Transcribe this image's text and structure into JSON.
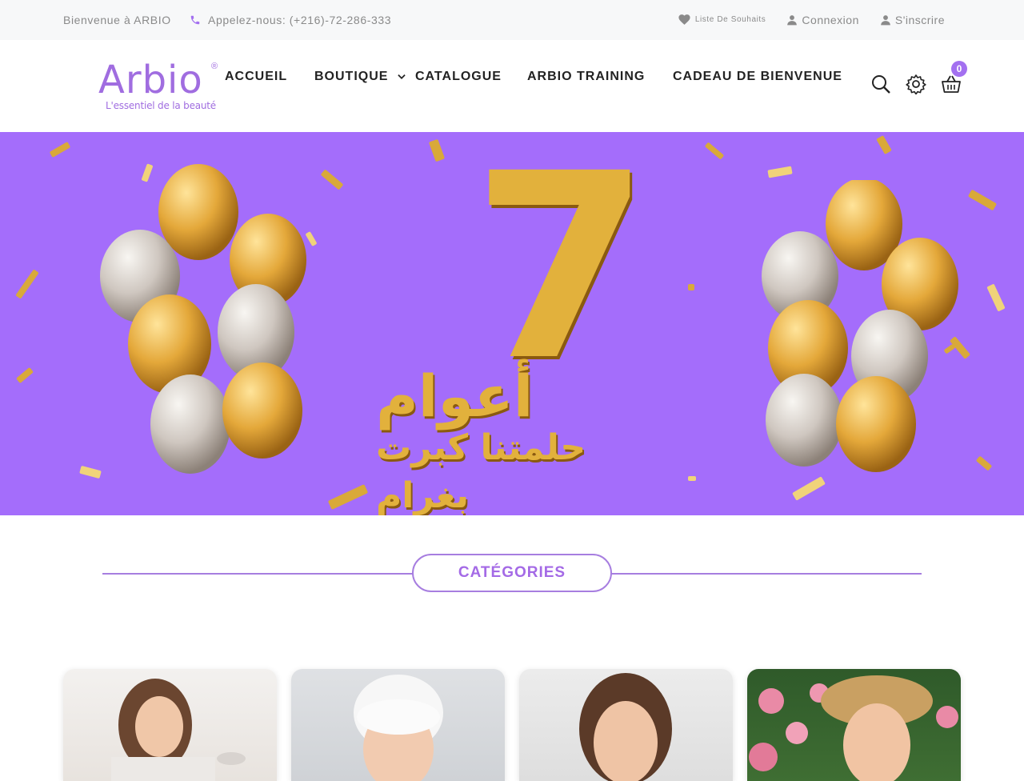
{
  "topbar": {
    "welcome": "Bienvenue à ARBIO",
    "phone": "Appelez-nous: (+216)-72-286-333",
    "wishlist": "Liste De Souhaits",
    "login": "Connexion",
    "register": "S'inscrire"
  },
  "logo": {
    "brand": "Arbio",
    "tagline": "L'essentiel de la beauté"
  },
  "nav": {
    "items": [
      {
        "label": "ACCUEIL"
      },
      {
        "label": "BOUTIQUE"
      },
      {
        "label": "CATALOGUE"
      },
      {
        "label": "ARBIO TRAINING"
      },
      {
        "label": "CADEAU DE BIENVENUE"
      }
    ]
  },
  "cart": {
    "count": "0"
  },
  "banner": {
    "number": "7",
    "headline": "أعوام",
    "subline": "حلمتنا كبرت بغرام"
  },
  "categories": {
    "title": "CATÉGORIES"
  },
  "colors": {
    "accent": "#a46ae6",
    "banner_bg": "#a46dfb",
    "gold": "#d9a939"
  }
}
